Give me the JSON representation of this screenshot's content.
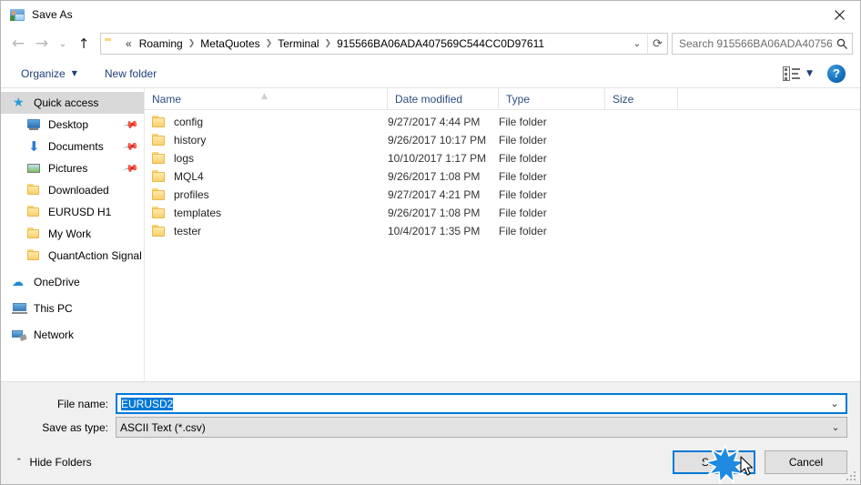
{
  "window": {
    "title": "Save As",
    "icon": "save-as-icon",
    "close_label": "✕"
  },
  "nav": {
    "back_icon": "back-arrow-icon",
    "forward_icon": "forward-arrow-icon",
    "recent_icon": "chevron-down-icon",
    "up_icon": "up-arrow-icon",
    "breadcrumb_prefix": "«",
    "breadcrumbs": [
      "Roaming",
      "MetaQuotes",
      "Terminal",
      "915566BA06ADA407569C544CC0D97611"
    ],
    "separator": "❯",
    "dropdown_icon": "chevron-down-icon",
    "refresh_icon": "refresh-icon"
  },
  "search": {
    "placeholder": "Search 915566BA06ADA40756...",
    "icon": "search-icon"
  },
  "toolbar": {
    "organize_label": "Organize",
    "organize_caret": "▼",
    "new_folder_label": "New folder",
    "view_icon": "list-view-icon",
    "view_caret": "▼",
    "help_label": "?"
  },
  "sidebar": {
    "items": [
      {
        "label": "Quick access",
        "icon": "star-icon",
        "selected": true,
        "indent": false,
        "pinned": false,
        "group": false
      },
      {
        "label": "Desktop",
        "icon": "monitor-icon",
        "selected": false,
        "indent": true,
        "pinned": true,
        "group": false
      },
      {
        "label": "Documents",
        "icon": "download-icon",
        "selected": false,
        "indent": true,
        "pinned": true,
        "group": false
      },
      {
        "label": "Pictures",
        "icon": "pictures-icon",
        "selected": false,
        "indent": true,
        "pinned": true,
        "group": false
      },
      {
        "label": "Downloaded",
        "icon": "folder-icon",
        "selected": false,
        "indent": true,
        "pinned": false,
        "group": false
      },
      {
        "label": "EURUSD H1",
        "icon": "folder-icon",
        "selected": false,
        "indent": true,
        "pinned": false,
        "group": false
      },
      {
        "label": "My Work",
        "icon": "folder-icon",
        "selected": false,
        "indent": true,
        "pinned": false,
        "group": false
      },
      {
        "label": "QuantAction Signal",
        "icon": "folder-icon",
        "selected": false,
        "indent": true,
        "pinned": false,
        "group": false
      },
      {
        "label": "OneDrive",
        "icon": "cloud-icon",
        "selected": false,
        "indent": false,
        "pinned": false,
        "group": true
      },
      {
        "label": "This PC",
        "icon": "computer-icon",
        "selected": false,
        "indent": false,
        "pinned": false,
        "group": true
      },
      {
        "label": "Network",
        "icon": "network-icon",
        "selected": false,
        "indent": false,
        "pinned": false,
        "group": true
      }
    ]
  },
  "filelist": {
    "columns": [
      "Name",
      "Date modified",
      "Type",
      "Size"
    ],
    "sort_indicator": "▲",
    "rows": [
      {
        "name": "config",
        "date": "9/27/2017 4:44 PM",
        "type": "File folder",
        "size": ""
      },
      {
        "name": "history",
        "date": "9/26/2017 10:17 PM",
        "type": "File folder",
        "size": ""
      },
      {
        "name": "logs",
        "date": "10/10/2017 1:17 PM",
        "type": "File folder",
        "size": ""
      },
      {
        "name": "MQL4",
        "date": "9/26/2017 1:08 PM",
        "type": "File folder",
        "size": ""
      },
      {
        "name": "profiles",
        "date": "9/27/2017 4:21 PM",
        "type": "File folder",
        "size": ""
      },
      {
        "name": "templates",
        "date": "9/26/2017 1:08 PM",
        "type": "File folder",
        "size": ""
      },
      {
        "name": "tester",
        "date": "10/4/2017 1:35 PM",
        "type": "File folder",
        "size": ""
      }
    ]
  },
  "form": {
    "filename_label": "File name:",
    "filename_value": "EURUSD2",
    "filetype_label": "Save as type:",
    "filetype_value": "ASCII Text (*.csv)",
    "caret": "⌄"
  },
  "footer": {
    "hide_folders_label": "Hide Folders",
    "hide_folders_caret": "⌃",
    "save_label": "Save",
    "cancel_label": "Cancel"
  },
  "colors": {
    "accent": "#0078d7",
    "header_text": "#2b4d7e",
    "toolbar_link": "#1c3f77",
    "selection": "#d9d9d9"
  }
}
